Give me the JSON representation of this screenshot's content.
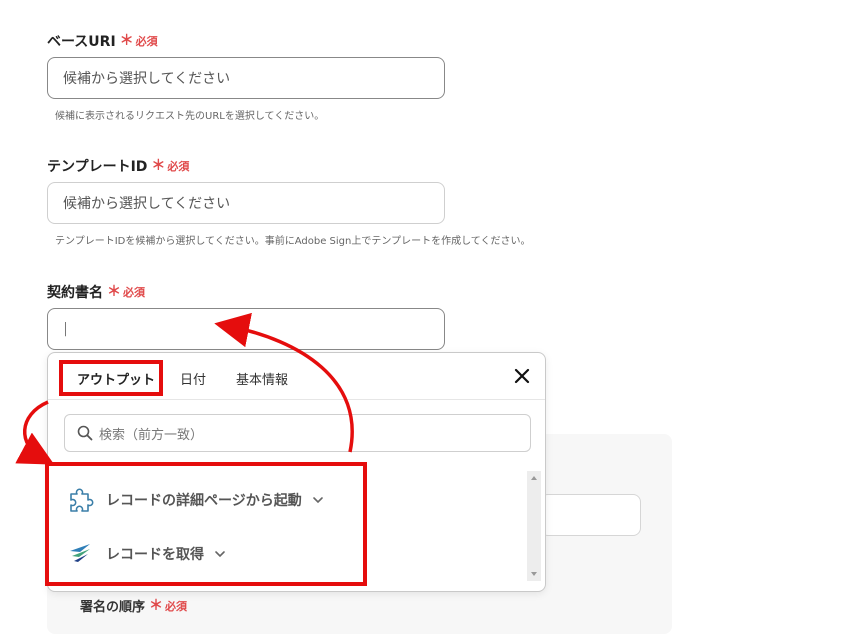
{
  "fields": {
    "base_uri": {
      "label": "ベースURI",
      "required": "必須",
      "placeholder": "候補から選択してください",
      "hint": "候補に表示されるリクエスト先のURLを選択してください。"
    },
    "template_id": {
      "label": "テンプレートID",
      "required": "必須",
      "placeholder": "候補から選択してください",
      "hint": "テンプレートIDを候補から選択してください。事前にAdobe Sign上でテンプレートを作成してください。"
    },
    "contract_name": {
      "label": "契約書名",
      "required": "必須",
      "value": "|"
    },
    "signing_order": {
      "label": "署名の順序",
      "required": "必須"
    }
  },
  "popup": {
    "tabs": [
      {
        "label": "アウトプット"
      },
      {
        "label": "日付"
      },
      {
        "label": "基本情報"
      }
    ],
    "search_placeholder": "検索（前方一致）",
    "items": [
      {
        "label": "レコードの詳細ページから起動",
        "icon": "puzzle-icon"
      },
      {
        "label": "レコードを取得",
        "icon": "feather-icon"
      }
    ]
  },
  "colors": {
    "required": "#e0494a",
    "highlight": "#e50d0d"
  }
}
